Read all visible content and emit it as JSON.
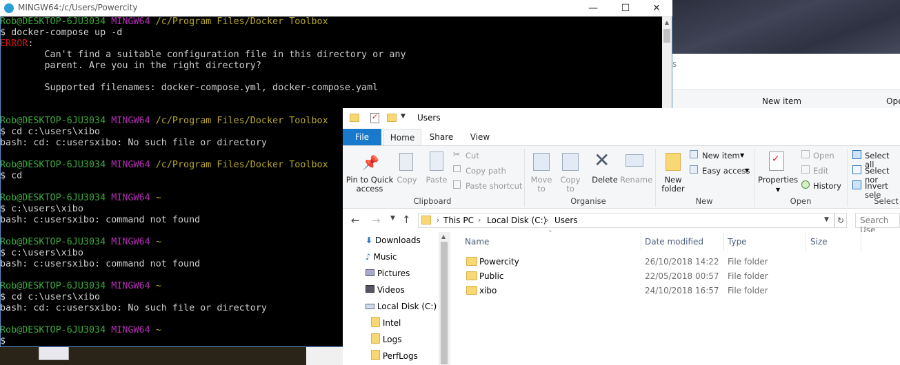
{
  "terminal": {
    "title": "MINGW64:/c/Users/Powercity",
    "lines": [
      [
        [
          "g",
          "Rob@DESKTOP-6JU3034 "
        ],
        [
          "m",
          "MINGW64 "
        ],
        [
          "y",
          "/c/Program Files/Docker Toolbox"
        ]
      ],
      [
        [
          "w",
          "$ docker-compose up -d"
        ]
      ],
      [
        [
          "r",
          "ERROR"
        ],
        [
          "w",
          ":"
        ]
      ],
      [
        [
          "w",
          "        Can't find a suitable configuration file in this directory or any"
        ]
      ],
      [
        [
          "w",
          "        parent. Are you in the right directory?"
        ]
      ],
      [
        [
          "w",
          ""
        ]
      ],
      [
        [
          "w",
          "        Supported filenames: docker-compose.yml, docker-compose.yaml"
        ]
      ],
      [
        [
          "w",
          ""
        ]
      ],
      [
        [
          "w",
          ""
        ]
      ],
      [
        [
          "g",
          "Rob@DESKTOP-6JU3034 "
        ],
        [
          "m",
          "MINGW64 "
        ],
        [
          "y",
          "/c/Program Files/Docker Toolbox"
        ]
      ],
      [
        [
          "w",
          "$ cd c:\\users\\xibo"
        ]
      ],
      [
        [
          "w",
          "bash: cd: c:usersxibo: No such file or directory"
        ]
      ],
      [
        [
          "w",
          ""
        ]
      ],
      [
        [
          "g",
          "Rob@DESKTOP-6JU3034 "
        ],
        [
          "m",
          "MINGW64 "
        ],
        [
          "y",
          "/c/Program Files/Docker Toolbox"
        ]
      ],
      [
        [
          "w",
          "$ cd"
        ]
      ],
      [
        [
          "w",
          ""
        ]
      ],
      [
        [
          "g",
          "Rob@DESKTOP-6JU3034 "
        ],
        [
          "m",
          "MINGW64 "
        ],
        [
          "y",
          "~"
        ]
      ],
      [
        [
          "w",
          "$ c:\\users\\xibo"
        ]
      ],
      [
        [
          "w",
          "bash: c:usersxibo: command not found"
        ]
      ],
      [
        [
          "w",
          ""
        ]
      ],
      [
        [
          "g",
          "Rob@DESKTOP-6JU3034 "
        ],
        [
          "m",
          "MINGW64 "
        ],
        [
          "y",
          "~"
        ]
      ],
      [
        [
          "w",
          "$ c:\\users\\xibo"
        ]
      ],
      [
        [
          "w",
          "bash: c:usersxibo: command not found"
        ]
      ],
      [
        [
          "w",
          ""
        ]
      ],
      [
        [
          "g",
          "Rob@DESKTOP-6JU3034 "
        ],
        [
          "m",
          "MINGW64 "
        ],
        [
          "y",
          "~"
        ]
      ],
      [
        [
          "w",
          "$ cd c:\\users\\xibo"
        ]
      ],
      [
        [
          "w",
          "bash: cd: c:usersxibo: No such file or directory"
        ]
      ],
      [
        [
          "w",
          ""
        ]
      ],
      [
        [
          "g",
          "Rob@DESKTOP-6JU3034 "
        ],
        [
          "m",
          "MINGW64 "
        ],
        [
          "y",
          "~"
        ]
      ],
      [
        [
          "w",
          "$"
        ]
      ]
    ]
  },
  "background_explorer": {
    "new_item": "New item",
    "open": "Ope",
    "fragment": "s"
  },
  "explorer": {
    "title": "Users",
    "tabs": [
      "File",
      "Home",
      "Share",
      "View"
    ],
    "ribbon": {
      "pin": "Pin to Quick access",
      "copy": "Copy",
      "paste": "Paste",
      "cut": "Cut",
      "copy_path": "Copy path",
      "paste_shortcut": "Paste shortcut",
      "clipboard": "Clipboard",
      "move_to": "Move to",
      "copy_to": "Copy to",
      "delete": "Delete",
      "rename": "Rename",
      "organise": "Organise",
      "new_folder": "New folder",
      "new_item": "New item",
      "easy_access": "Easy access",
      "new": "New",
      "properties": "Properties",
      "open": "Open",
      "edit": "Edit",
      "history": "History",
      "open_group": "Open",
      "select_all": "Select all",
      "select_none": "Select nor",
      "invert_selection": "Invert sele",
      "select": "Select"
    },
    "breadcrumb": [
      "This PC",
      "Local Disk (C:)",
      "Users"
    ],
    "search_placeholder": "Search Use",
    "nav": [
      "Downloads",
      "Music",
      "Pictures",
      "Videos",
      "Local Disk (C:)",
      "Intel",
      "Logs",
      "PerfLogs"
    ],
    "columns": [
      "Name",
      "Date modified",
      "Type",
      "Size"
    ],
    "files": [
      {
        "name": "Powercity",
        "date": "26/10/2018 14:22",
        "type": "File folder"
      },
      {
        "name": "Public",
        "date": "22/05/2018 00:57",
        "type": "File folder"
      },
      {
        "name": "xibo",
        "date": "24/10/2018 16:57",
        "type": "File folder"
      }
    ]
  }
}
